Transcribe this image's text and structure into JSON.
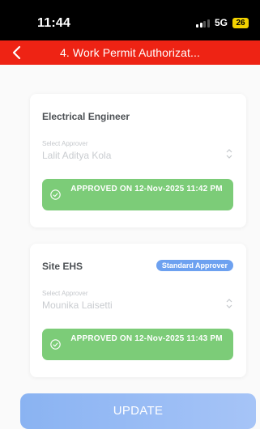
{
  "status_bar": {
    "time": "11:44",
    "network": "5G",
    "battery": "26"
  },
  "header": {
    "title": "4. Work Permit Authorizat...",
    "back_icon": "chevron-left-icon"
  },
  "approvers": [
    {
      "role": "Electrical Engineer",
      "badge": "",
      "select_label": "Select Approver",
      "approver_name": "Lalit Aditya Kola",
      "status": "APPROVED ON 12-Nov-2025 11:42 PM"
    },
    {
      "role": "Site EHS",
      "badge": "Standard Approver",
      "select_label": "Select Approver",
      "approver_name": "Mounika Laisetti",
      "status": "APPROVED ON 12-Nov-2025 11:43 PM"
    }
  ],
  "update_label": "UPDATE",
  "colors": {
    "header_red": "#ee2314",
    "approved_green": "#7ccc78",
    "badge_blue": "#6da1f0",
    "button_blue": "#8ab3f2"
  }
}
